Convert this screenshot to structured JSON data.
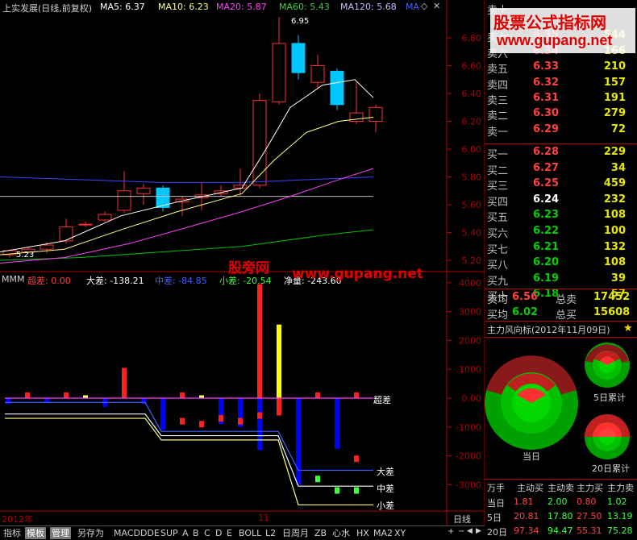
{
  "header": {
    "stock": "上实发展(日线,前复权)",
    "ma5": "MA5: 6.37",
    "ma10": "MA10: 6.23",
    "ma20": "MA20: 5.87",
    "ma60": "MA60: 5.43",
    "ma120": "MA120: 5.68",
    "ma_tag": "MA"
  },
  "price_axis": [
    "6.80",
    "6.60",
    "6.40",
    "6.20",
    "6.00",
    "5.80",
    "5.60",
    "5.40",
    "5.20"
  ],
  "price_annotations": {
    "high": "6.95",
    "low": "5.23"
  },
  "indicator": {
    "name": "MMM",
    "chao": "超差: 0.00",
    "da": "大差: -138.21",
    "zhong": "中差: -84.85",
    "xiao": "小差: -20.54",
    "jing": "净量: -243.60"
  },
  "indicator_axis": [
    "4000",
    "3000",
    "2000",
    "1000",
    "0.00",
    "-1000",
    "-2000",
    "-3000"
  ],
  "indicator_line_labels": {
    "chao": "超差",
    "da": "大差",
    "zhong": "中差",
    "xiao": "小差"
  },
  "watermark": {
    "line1": "股票公式指标网",
    "line2": "www.gupang.net",
    "center1": "股旁网",
    "center2": "www.gupang.net"
  },
  "time_axis": {
    "year": "2012年",
    "month": "11"
  },
  "period_label": "日线",
  "orderbook": {
    "sell": [
      {
        "label": "卖十",
        "price": "",
        "vol": ""
      },
      {
        "label": "卖七",
        "price": "6.35",
        "vol": "544"
      },
      {
        "label": "卖六",
        "price": "6.34",
        "vol": "166"
      },
      {
        "label": "卖五",
        "price": "6.33",
        "vol": "210"
      },
      {
        "label": "卖四",
        "price": "6.32",
        "vol": "157"
      },
      {
        "label": "卖三",
        "price": "6.31",
        "vol": "191"
      },
      {
        "label": "卖二",
        "price": "6.30",
        "vol": "279"
      },
      {
        "label": "卖一",
        "price": "6.29",
        "vol": "72"
      }
    ],
    "buy": [
      {
        "label": "买一",
        "price": "6.28",
        "vol": "229",
        "cls": "up"
      },
      {
        "label": "买二",
        "price": "6.27",
        "vol": "34",
        "cls": "up"
      },
      {
        "label": "买三",
        "price": "6.25",
        "vol": "459",
        "cls": "up"
      },
      {
        "label": "买四",
        "price": "6.24",
        "vol": "232",
        "cls": "flat"
      },
      {
        "label": "买五",
        "price": "6.23",
        "vol": "108",
        "cls": "dn"
      },
      {
        "label": "买六",
        "price": "6.22",
        "vol": "100",
        "cls": "dn"
      },
      {
        "label": "买七",
        "price": "6.21",
        "vol": "132",
        "cls": "dn"
      },
      {
        "label": "买八",
        "price": "6.20",
        "vol": "108",
        "cls": "dn"
      },
      {
        "label": "买九",
        "price": "6.19",
        "vol": "39",
        "cls": "dn"
      },
      {
        "label": "买十",
        "price": "6.18",
        "vol": "57",
        "cls": "dn"
      }
    ],
    "avg_sell_label": "卖均",
    "avg_sell": "6.56",
    "total_sell_label": "总卖",
    "total_sell": "17452",
    "avg_buy_label": "买均",
    "avg_buy": "6.02",
    "total_buy_label": "总买",
    "total_buy": "15608"
  },
  "wind": {
    "title": "主力风向标(2012年11月09日)",
    "today": "当日",
    "d5": "5日累计",
    "d20": "20日累计"
  },
  "flow": {
    "header": [
      "万手",
      "主动买",
      "主动卖",
      "主力买",
      "主力卖"
    ],
    "rows": [
      {
        "label": "当日",
        "v": [
          "1.81",
          "2.00",
          "0.80",
          "1.02"
        ]
      },
      {
        "label": "5日",
        "v": [
          "20.81",
          "17.80",
          "27.50",
          "13.19"
        ]
      },
      {
        "label": "20日",
        "v": [
          "97.34",
          "94.47",
          "55.31",
          "75.28"
        ]
      }
    ]
  },
  "toolbar": [
    "指标",
    "模板",
    "管理",
    "另存为",
    "MACD",
    "DDE",
    "SUP",
    "A",
    "B",
    "C",
    "D",
    "E",
    "BOLL",
    "L2",
    "日周月",
    "ZB",
    "心水",
    "HX",
    "MA2",
    "XY"
  ],
  "colors": {
    "up": "#ff3030",
    "down": "#00c8ff",
    "ma5": "#ffffff",
    "ma10": "#ffff80",
    "ma20": "#ff40ff",
    "ma60": "#00c000",
    "ma120": "#4040ff"
  }
}
